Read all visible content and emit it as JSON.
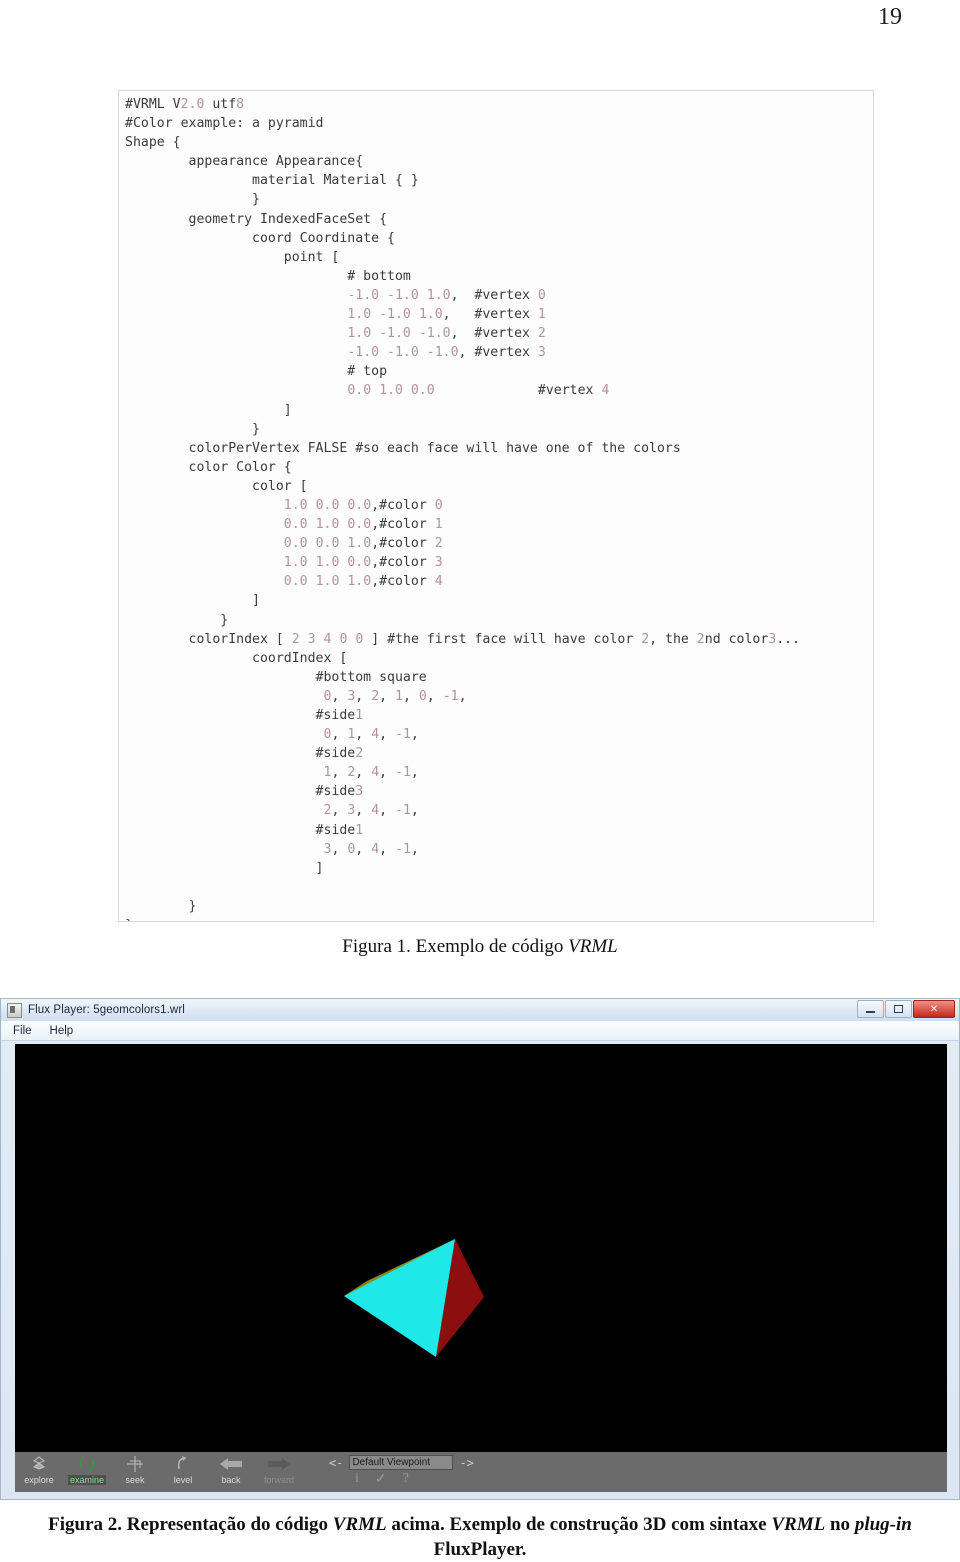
{
  "page": {
    "number": "19"
  },
  "figure1": {
    "caption_prefix": "Figura 1. Exemplo de código ",
    "caption_italic": "VRML",
    "code_lines": [
      {
        "indent": 0,
        "text": "#VRML V2.0 utf8"
      },
      {
        "indent": 0,
        "text": "#Color example: a pyramid"
      },
      {
        "indent": 0,
        "text": "Shape {"
      },
      {
        "indent": 8,
        "text": "appearance Appearance{"
      },
      {
        "indent": 16,
        "text": "material Material { }"
      },
      {
        "indent": 16,
        "text": "}"
      },
      {
        "indent": 8,
        "text": "geometry IndexedFaceSet {"
      },
      {
        "indent": 16,
        "text": "coord Coordinate {"
      },
      {
        "indent": 20,
        "text": "point ["
      },
      {
        "indent": 28,
        "text": "# bottom"
      },
      {
        "indent": 28,
        "text": "-1.0 -1.0 1.0,  #vertex 0"
      },
      {
        "indent": 28,
        "text": "1.0 -1.0 1.0,   #vertex 1"
      },
      {
        "indent": 28,
        "text": "1.0 -1.0 -1.0,  #vertex 2"
      },
      {
        "indent": 28,
        "text": "-1.0 -1.0 -1.0, #vertex 3"
      },
      {
        "indent": 28,
        "text": "# top"
      },
      {
        "indent": 28,
        "text": "0.0 1.0 0.0             #vertex 4"
      },
      {
        "indent": 20,
        "text": "]"
      },
      {
        "indent": 16,
        "text": "}"
      },
      {
        "indent": 8,
        "text": "colorPerVertex FALSE #so each face will have one of the colors"
      },
      {
        "indent": 8,
        "text": "color Color {"
      },
      {
        "indent": 16,
        "text": "color ["
      },
      {
        "indent": 20,
        "text": "1.0 0.0 0.0,#color 0"
      },
      {
        "indent": 20,
        "text": "0.0 1.0 0.0,#color 1"
      },
      {
        "indent": 20,
        "text": "0.0 0.0 1.0,#color 2"
      },
      {
        "indent": 20,
        "text": "1.0 1.0 0.0,#color 3"
      },
      {
        "indent": 20,
        "text": "0.0 1.0 1.0,#color 4"
      },
      {
        "indent": 16,
        "text": "]"
      },
      {
        "indent": 12,
        "text": "}"
      },
      {
        "indent": 8,
        "text": "colorIndex [ 2 3 4 0 0 ] #the first face will have color 2, the 2nd color3..."
      },
      {
        "indent": 16,
        "text": "coordIndex ["
      },
      {
        "indent": 24,
        "text": "#bottom square"
      },
      {
        "indent": 24,
        "text": " 0, 3, 2, 1, 0, -1,"
      },
      {
        "indent": 24,
        "text": "#side1"
      },
      {
        "indent": 24,
        "text": " 0, 1, 4, -1,"
      },
      {
        "indent": 24,
        "text": "#side2"
      },
      {
        "indent": 24,
        "text": " 1, 2, 4, -1,"
      },
      {
        "indent": 24,
        "text": "#side3"
      },
      {
        "indent": 24,
        "text": " 2, 3, 4, -1,"
      },
      {
        "indent": 24,
        "text": "#side1"
      },
      {
        "indent": 24,
        "text": " 3, 0, 4, -1,"
      },
      {
        "indent": 24,
        "text": "]"
      },
      {
        "indent": 0,
        "text": ""
      },
      {
        "indent": 8,
        "text": "}"
      },
      {
        "indent": 0,
        "text": "}"
      }
    ]
  },
  "player": {
    "title": "Flux Player: 5geomcolors1.wrl",
    "menus": [
      {
        "label": "File"
      },
      {
        "label": "Help"
      }
    ],
    "window_controls": {
      "minimize": "—",
      "restore": "❐",
      "close": "✕"
    },
    "toolbar": {
      "buttons": [
        {
          "label": "explore",
          "icon": "explore-icon",
          "state": "normal"
        },
        {
          "label": "examine",
          "icon": "examine-icon",
          "state": "active"
        },
        {
          "label": "seek",
          "icon": "seek-icon",
          "state": "normal"
        },
        {
          "label": "level",
          "icon": "level-icon",
          "state": "normal"
        },
        {
          "label": "back",
          "icon": "back-arrow-icon",
          "state": "normal"
        },
        {
          "label": "forward",
          "icon": "forward-arrow-icon",
          "state": "disabled"
        }
      ],
      "viewpoint": {
        "prev_label": "<-",
        "next_label": "->",
        "value": "Default Viewpoint",
        "info_icon": "i",
        "check_icon": "✓",
        "help_icon": "?"
      }
    },
    "render": {
      "background": "#000000",
      "face_colors": {
        "top_left": "#8a8a10",
        "front": "#1fe8e8",
        "right": "#8c0f0f"
      }
    }
  },
  "figure2": {
    "caption_line1_a": "Figura 2. Representação do código ",
    "caption_line1_it1": "VRML",
    "caption_line1_b": " acima. Exemplo de construção 3D com sintaxe ",
    "caption_line1_it2": "VRML",
    "caption_line1_c": " no ",
    "caption_line1_it3": "plug-in",
    "caption_line2": "FluxPlayer."
  }
}
